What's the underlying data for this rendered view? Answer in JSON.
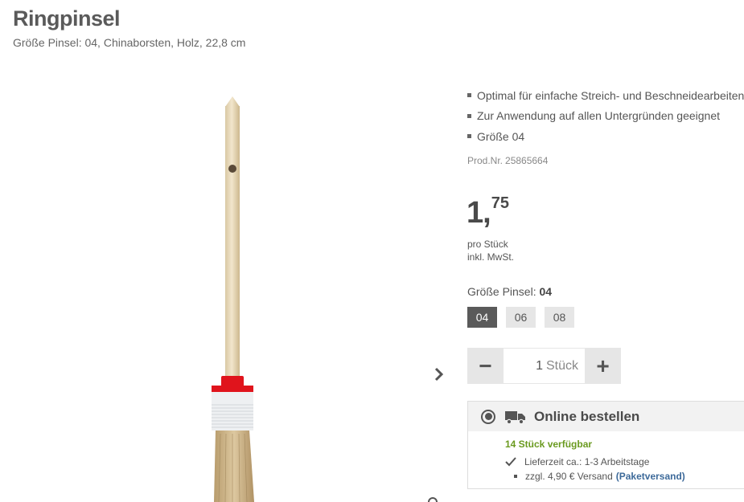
{
  "product": {
    "title": "Ringpinsel",
    "subtitle": "Größe Pinsel: 04, Chinaborsten, Holz, 22,8 cm"
  },
  "features": [
    "Optimal für einfache Streich- und Beschneidearbeiten",
    "Zur Anwendung auf allen Untergründen geeignet",
    "Größe 04"
  ],
  "prodnr": {
    "label": "Prod.Nr.",
    "value": "25865664"
  },
  "price": {
    "euros": "1,",
    "cents": "75",
    "unit": "pro Stück",
    "tax": "inkl. MwSt."
  },
  "size": {
    "label": "Größe Pinsel:",
    "selected": "04",
    "options": [
      "04",
      "06",
      "08"
    ]
  },
  "quantity": {
    "minus": "−",
    "value": "1",
    "unit": "Stück",
    "plus": "+"
  },
  "order": {
    "title": "Online bestellen",
    "availability": "14 Stück verfügbar",
    "delivery": "Lieferzeit ca.: 1-3 Arbeitstage",
    "shipping": "zzgl. 4,90 € Versand",
    "shipping_link": "(Paketversand)"
  },
  "colors": {
    "accent_green": "#6a9a1f",
    "link_blue": "#3d6a9a",
    "active_size": "#5a5a5a",
    "brush_ring_red": "#e0141c"
  },
  "icons": [
    "chevron-right-icon",
    "truck-icon",
    "check-icon",
    "radio-icon",
    "zoom-icon"
  ]
}
